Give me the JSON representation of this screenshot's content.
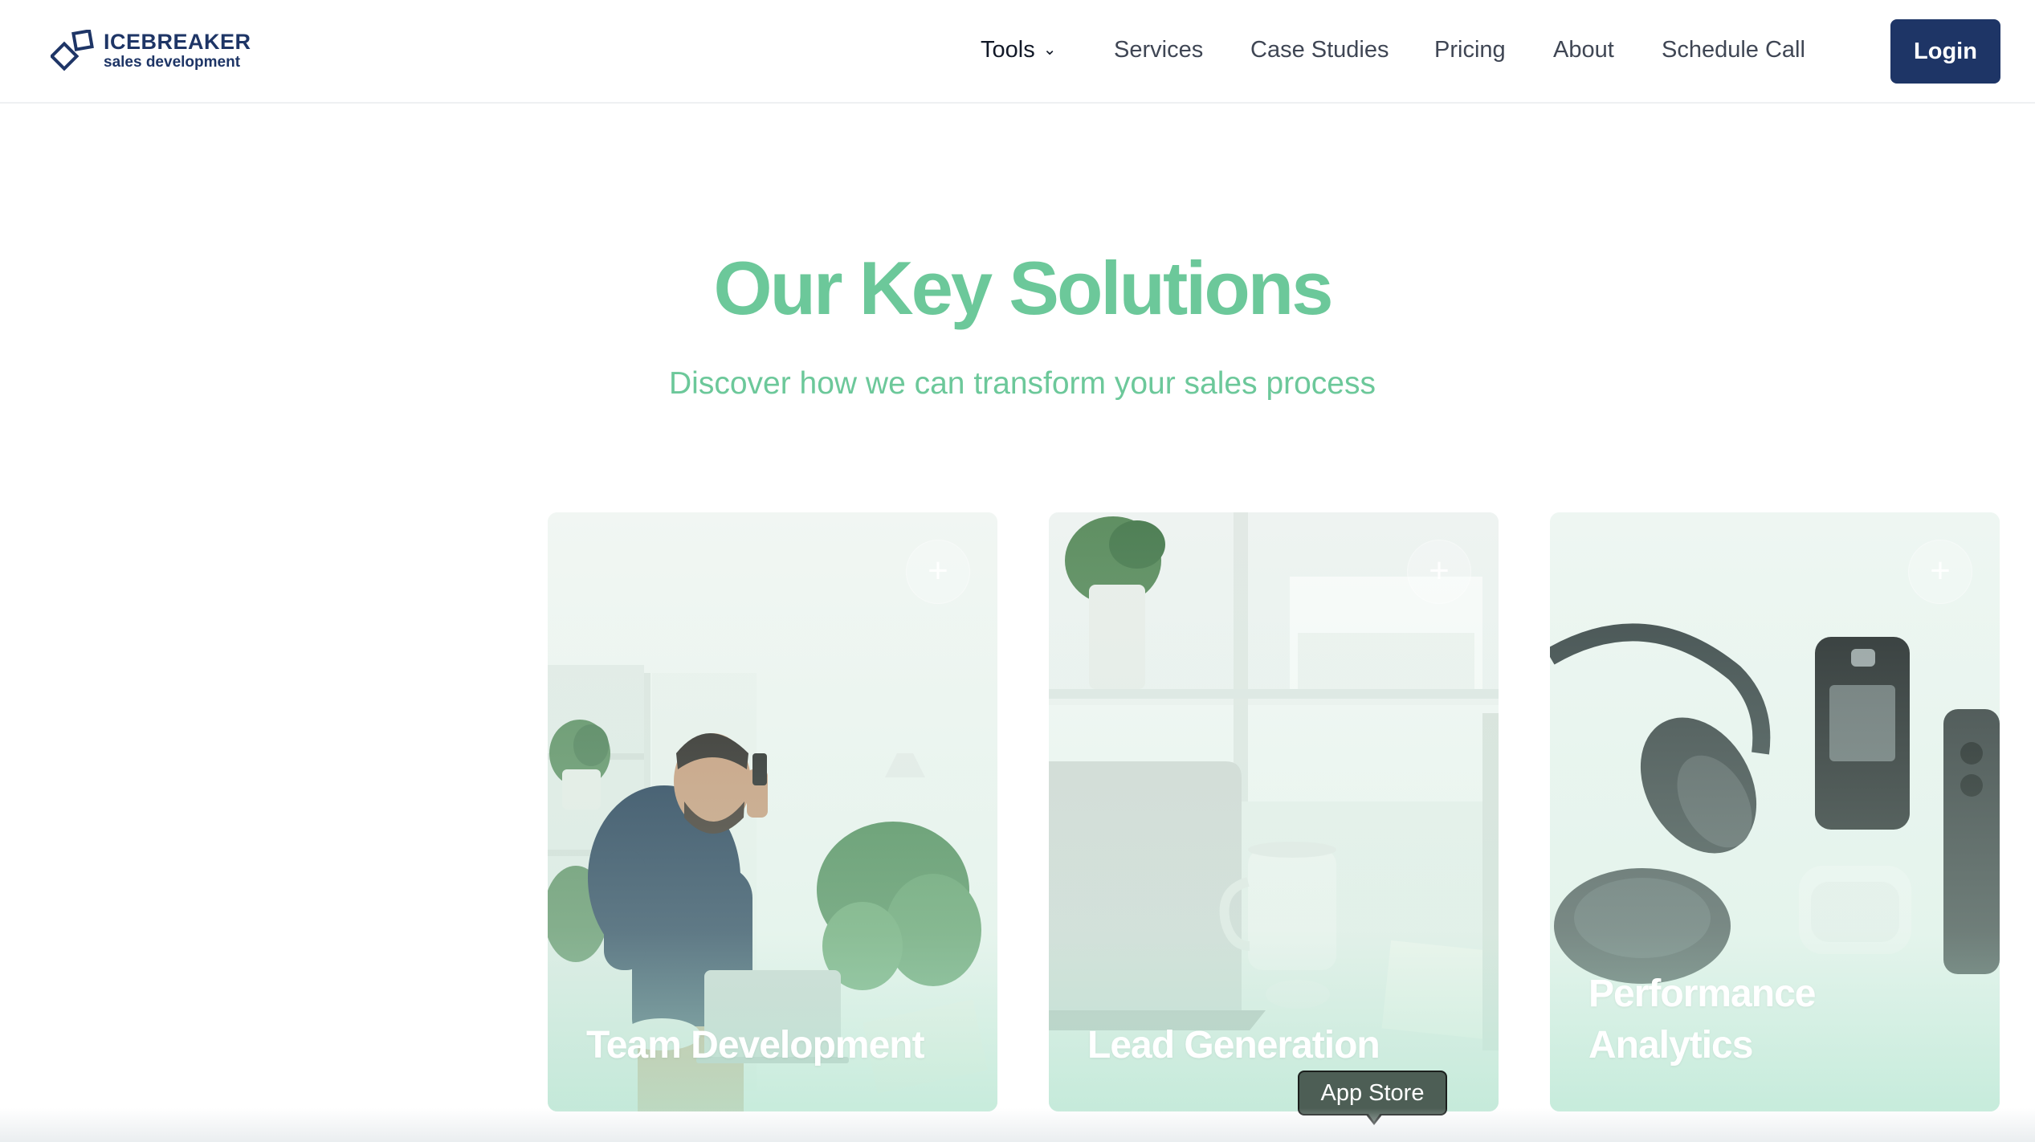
{
  "brand": {
    "name": "ICEBREAKER",
    "tagline": "sales development",
    "color": "#1e3566",
    "logo_icon": "diamond-squares-logo-icon"
  },
  "nav": {
    "tools_label": "Tools",
    "tools_icon": "chevron-down-icon",
    "services_label": "Services",
    "case_studies_label": "Case Studies",
    "pricing_label": "Pricing",
    "about_label": "About",
    "schedule_call_label": "Schedule Call",
    "login_label": "Login"
  },
  "hero": {
    "title": "Our Key Solutions",
    "subtitle": "Discover how we can transform your sales process",
    "accent_color": "#6cc89a"
  },
  "cards": [
    {
      "title": "Team Development",
      "expand_icon": "plus-icon",
      "image": "man-on-phone-photo"
    },
    {
      "title": "Lead Generation",
      "expand_icon": "plus-icon",
      "image": "desk-laptop-mug-photo"
    },
    {
      "title": "Performance Analytics",
      "expand_icon": "plus-icon",
      "image": "headphones-phones-photo"
    }
  ],
  "tooltip": {
    "text": "App Store"
  }
}
